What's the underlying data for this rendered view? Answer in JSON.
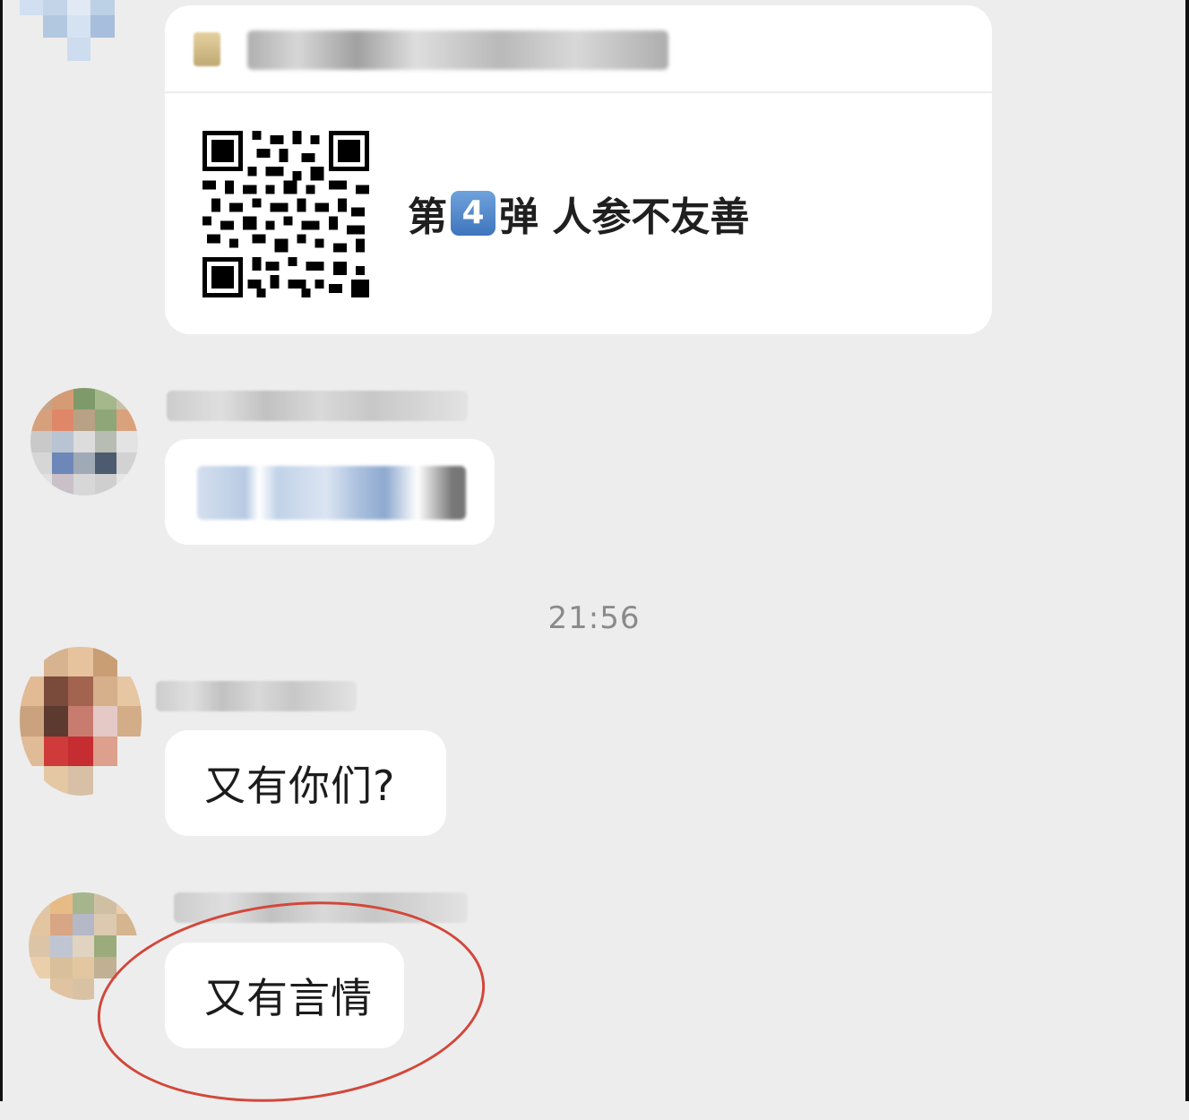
{
  "card": {
    "title_prefix": "第",
    "title_number": "4",
    "title_suffix": "弹 人参不友善"
  },
  "timestamp": "21:56",
  "messages": [
    {
      "text": "又有你们?"
    },
    {
      "text": "又有言情"
    }
  ],
  "colors": {
    "background": "#ededed",
    "bubble": "#ffffff",
    "highlight": "#d2473a",
    "badge": "#4f86c8"
  },
  "icons": [
    "qr-code-icon"
  ]
}
